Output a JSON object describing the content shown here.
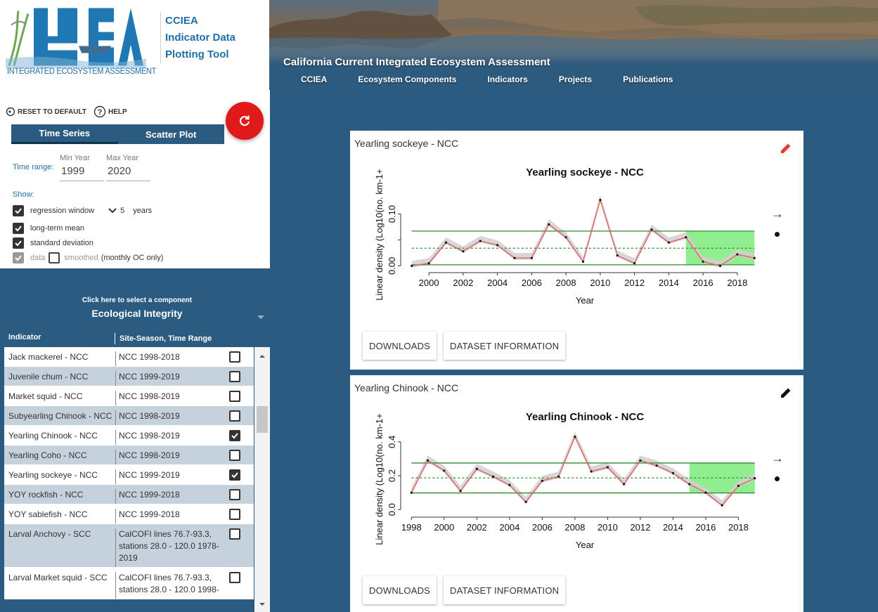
{
  "logo": {
    "caption": "INTEGRATED ECOSYSTEM ASSESSMENT",
    "title_lines": [
      "CCIEA",
      "Indicator Data",
      "Plotting Tool"
    ]
  },
  "banner": {
    "title": "California Current Integrated Ecosystem Assessment",
    "nav": [
      "CCIEA",
      "Ecosystem Components",
      "Indicators",
      "Projects",
      "Publications"
    ]
  },
  "controls": {
    "reset_label": "RESET TO DEFAULT",
    "help_label": "HELP",
    "tabs": [
      "Time Series",
      "Scatter Plot"
    ],
    "time_range_label": "Time range:",
    "min_year_label": "Min Year",
    "min_year": "1999",
    "max_year_label": "Max Year",
    "max_year": "2020",
    "show_label": "Show:",
    "regression_label": "regression window",
    "regression_value": "5",
    "regression_unit": "years",
    "longterm_label": "long-term mean",
    "stdev_label": "standard deviation",
    "data_label": "data",
    "smoothed_label": "smoothed",
    "monthly_note": "(monthly OC only)"
  },
  "component": {
    "hint": "Click here to select a component",
    "selected": "Ecological Integrity"
  },
  "table": {
    "headers": [
      "Indicator",
      "Site-Season, Time Range"
    ],
    "rows": [
      {
        "indicator": "Jack mackerel - NCC",
        "range": "NCC 1998-2018",
        "checked": false
      },
      {
        "indicator": "Juvenile chum - NCC",
        "range": "NCC 1999-2019",
        "checked": false
      },
      {
        "indicator": "Market squid - NCC",
        "range": "NCC 1998-2019",
        "checked": false
      },
      {
        "indicator": "Subyearling Chinook - NCC",
        "range": "NCC 1998-2019",
        "checked": false
      },
      {
        "indicator": "Yearling Chinook - NCC",
        "range": "NCC 1998-2019",
        "checked": true
      },
      {
        "indicator": "Yearling Coho - NCC",
        "range": "NCC 1998-2019",
        "checked": false
      },
      {
        "indicator": "Yearling sockeye - NCC",
        "range": "NCC 1999-2019",
        "checked": true
      },
      {
        "indicator": "YOY rockfish - NCC",
        "range": "NCC 1999-2018",
        "checked": false
      },
      {
        "indicator": "YOY sablefish - NCC",
        "range": "NCC 1999-2018",
        "checked": false
      },
      {
        "indicator": "Larval Anchovy - SCC",
        "range": "CalCOFI lines 76.7-93.3, stations 28.0 - 120.0 1978-2019",
        "checked": false
      },
      {
        "indicator": "Larval Market squid - SCC",
        "range": "CalCOFI lines 76.7-93.3, stations 28.0 - 120.0 1998-",
        "checked": false
      }
    ]
  },
  "cards": [
    {
      "label": "Yearling sockeye - NCC",
      "edit_color": "#e53935"
    },
    {
      "label": "Yearling Chinook - NCC",
      "edit_color": "#111111"
    }
  ],
  "buttons": {
    "downloads": "DOWNLOADS",
    "dataset_info": "DATASET INFORMATION"
  },
  "chart_data": [
    {
      "type": "line",
      "title": "Yearling sockeye - NCC",
      "xlabel": "Year",
      "ylabel": "Linear density (Log10(no. km-1+",
      "x": [
        1999,
        2000,
        2001,
        2002,
        2003,
        2004,
        2005,
        2006,
        2007,
        2008,
        2009,
        2010,
        2011,
        2012,
        2013,
        2014,
        2015,
        2016,
        2017,
        2018,
        2019
      ],
      "values": [
        0.0,
        0.005,
        0.045,
        0.028,
        0.048,
        0.04,
        0.015,
        0.015,
        0.08,
        0.055,
        0.008,
        0.127,
        0.02,
        0.005,
        0.07,
        0.045,
        0.055,
        0.008,
        0.0,
        0.022,
        0.015
      ],
      "mean": 0.034,
      "sd_upper": 0.067,
      "sd_lower": 0.002,
      "xlim": [
        1998.6,
        2019.4
      ],
      "ylim": [
        -0.005,
        0.155
      ],
      "xticks": [
        2000,
        2002,
        2004,
        2006,
        2008,
        2010,
        2012,
        2014,
        2016,
        2018
      ],
      "yticks": [
        0.0,
        0.05,
        0.1
      ],
      "ytick_labels": [
        "0.00",
        "",
        "0.10"
      ],
      "recent_window": [
        2015,
        2019
      ],
      "line_color": "#e06666",
      "band_color": "#d0d0d0",
      "mean_color": "#2e8b2e",
      "window_color": "#90ee90"
    },
    {
      "type": "line",
      "title": "Yearling Chinook - NCC",
      "xlabel": "Year",
      "ylabel": "Linear density (Log10(no. km-1+",
      "x": [
        1998,
        1999,
        2000,
        2001,
        2002,
        2003,
        2004,
        2005,
        2006,
        2007,
        2008,
        2009,
        2010,
        2011,
        2012,
        2013,
        2014,
        2015,
        2016,
        2017,
        2018,
        2019
      ],
      "values": [
        0.1,
        0.29,
        0.23,
        0.11,
        0.24,
        0.195,
        0.145,
        0.045,
        0.17,
        0.195,
        0.43,
        0.225,
        0.25,
        0.15,
        0.29,
        0.26,
        0.215,
        0.15,
        0.1,
        0.025,
        0.14,
        0.185
      ],
      "mean": 0.187,
      "sd_upper": 0.275,
      "sd_lower": 0.098,
      "xlim": [
        1997.6,
        2019.4
      ],
      "ylim": [
        -0.02,
        0.47
      ],
      "xticks": [
        1998,
        2000,
        2002,
        2004,
        2006,
        2008,
        2010,
        2012,
        2014,
        2016,
        2018
      ],
      "yticks": [
        0.0,
        0.2,
        0.4
      ],
      "ytick_labels": [
        "0.0",
        "0.2",
        "0.4"
      ],
      "recent_window": [
        2015,
        2019
      ],
      "line_color": "#e06666",
      "band_color": "#d0d0d0",
      "mean_color": "#2e8b2e",
      "window_color": "#90ee90"
    }
  ]
}
